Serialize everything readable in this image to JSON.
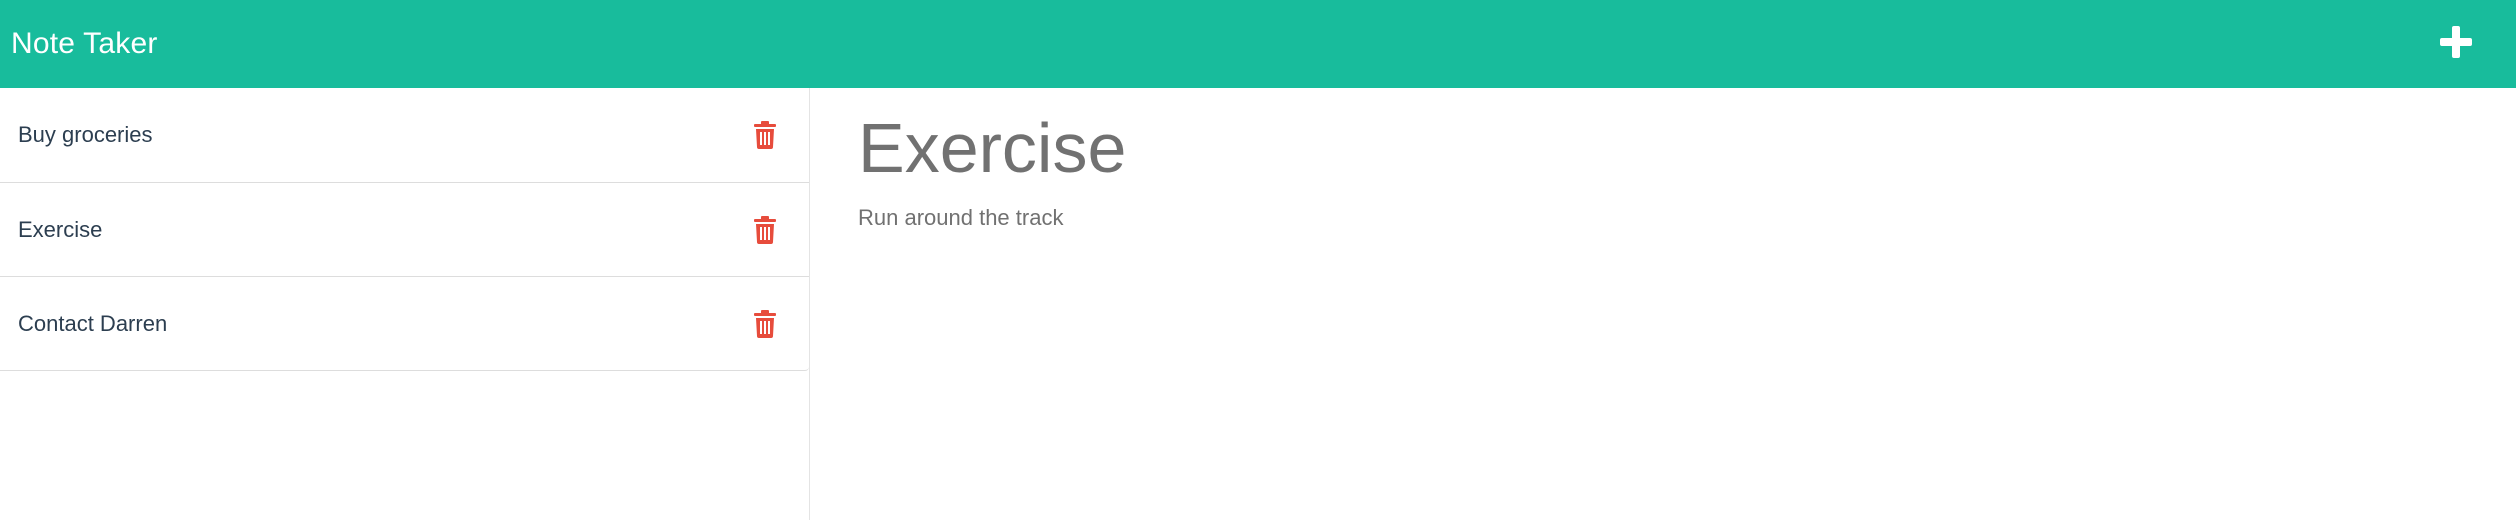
{
  "app": {
    "title": "Note Taker"
  },
  "toolbar": {
    "add_icon": "plus-icon"
  },
  "notes": [
    {
      "title": "Buy groceries",
      "delete_icon": "trash-icon"
    },
    {
      "title": "Exercise",
      "delete_icon": "trash-icon"
    },
    {
      "title": "Contact Darren",
      "delete_icon": "trash-icon"
    }
  ],
  "active_note": {
    "title": "Exercise",
    "text": "Run around the track"
  },
  "colors": {
    "navbar": "#18bc9c",
    "delete": "#e74c3c",
    "detail_text": "#717171"
  }
}
